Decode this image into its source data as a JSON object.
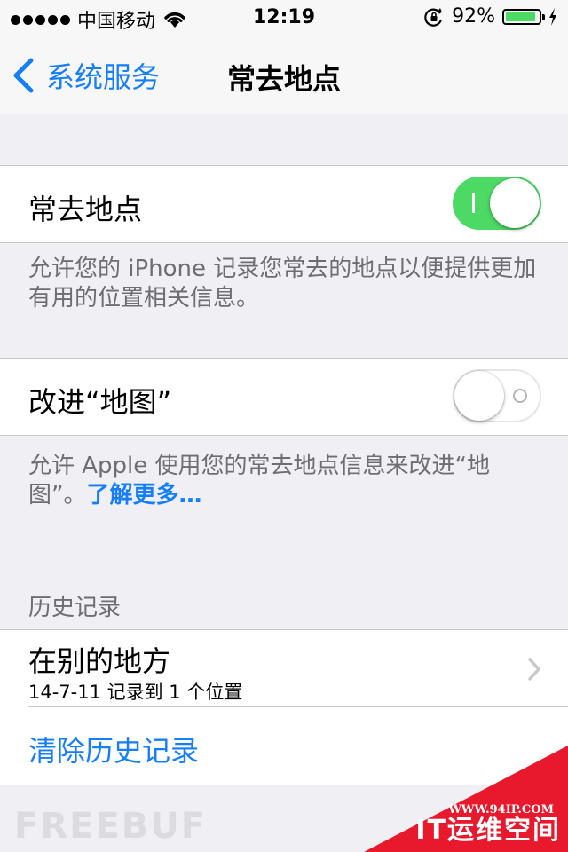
{
  "status_bar": {
    "carrier": "中国移动",
    "time": "12:19",
    "battery_percent": "92%",
    "battery_level": 0.92,
    "icons": [
      "signal-dots-icon",
      "wifi-icon",
      "rotation-lock-icon",
      "battery-icon",
      "charging-bolt-icon"
    ]
  },
  "nav": {
    "back_label": "系统服务",
    "title": "常去地点"
  },
  "frequent_locations": {
    "label": "常去地点",
    "switch_on": true,
    "footer": "允许您的 iPhone 记录您常去的地点以便提供更加有用的位置相关信息。"
  },
  "improve_maps": {
    "label": "改进“地图”",
    "switch_on": false,
    "footer_text": "允许 Apple 使用您的常去地点信息来改进“地图”。",
    "footer_link": "了解更多…"
  },
  "history": {
    "header": "历史记录",
    "item_title": "在别的地方",
    "item_subtitle": "14-7-11 记录到 1 个位置",
    "clear_label": "清除历史记录"
  },
  "watermarks": {
    "freebuf": "FREEBUF",
    "url": "WWW.94IP.COM",
    "brand": "IT运维空间"
  },
  "colors": {
    "accent": "#157efb",
    "switch_on": "#4cd964",
    "background": "#efeff4",
    "corner_banner": "#e8192c"
  }
}
